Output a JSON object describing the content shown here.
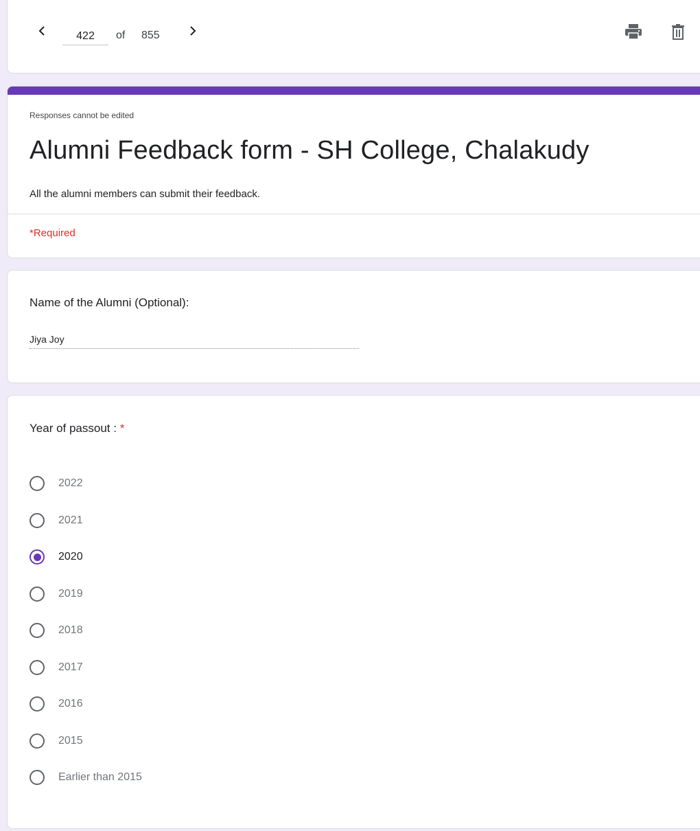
{
  "navigation": {
    "current": "422",
    "of_label": "of",
    "total": "855",
    "prev_icon": "chevron-left-icon",
    "next_icon": "chevron-right-icon",
    "print_icon": "print-icon",
    "delete_icon": "trash-icon"
  },
  "header": {
    "note": "Responses cannot be edited",
    "title": "Alumni Feedback form - SH College, Chalakudy",
    "description": "All the alumni members can submit their feedback.",
    "required_note": "*Required",
    "accent_color": "#673ab7"
  },
  "questions": {
    "name": {
      "title": "Name of the Alumni (Optional):",
      "answer": "Jiya Joy"
    },
    "year": {
      "title": "Year of passout : ",
      "required_mark": "*",
      "options": [
        "2022",
        "2021",
        "2020",
        "2019",
        "2018",
        "2017",
        "2016",
        "2015",
        "Earlier than 2015"
      ],
      "selected": "2020"
    }
  },
  "colors": {
    "background": "#f0ebf8",
    "accent": "#673ab7",
    "required": "#d93025"
  }
}
